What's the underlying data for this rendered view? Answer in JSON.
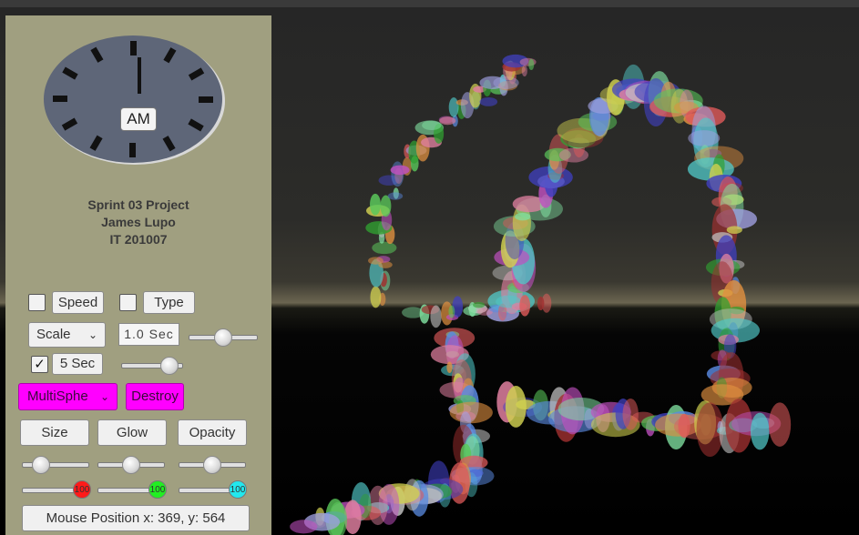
{
  "clock": {
    "period_label": "AM"
  },
  "project": {
    "title": "Sprint 03 Project",
    "author": "James Lupo",
    "course": "IT 201007"
  },
  "controls": {
    "speed": {
      "label": "Speed",
      "checked": false
    },
    "type": {
      "label": "Type",
      "checked": false
    },
    "scale_select": {
      "value": "Scale"
    },
    "interval_field": {
      "value": "1.0 Sec"
    },
    "interval_slider": {
      "level": 0.5
    },
    "timer_checkbox": {
      "checked": true,
      "mark": "✓"
    },
    "timer_label": "5 Sec",
    "timer_slider": {
      "level": 0.9
    },
    "shape_select": {
      "value": "MultiSphe"
    },
    "destroy_label": "Destroy",
    "size_label": "Size",
    "glow_label": "Glow",
    "opacity_label": "Opacity",
    "size_slider": {
      "level": 0.2
    },
    "glow_slider": {
      "level": 0.5
    },
    "opacity_slider": {
      "level": 0.5
    },
    "red_slider": {
      "value": "100",
      "color": "#ff1a1a"
    },
    "green_slider": {
      "value": "100",
      "color": "#22ee22"
    },
    "blue_slider": {
      "value": "100",
      "color": "#22e8ee"
    }
  },
  "status": {
    "mouse_position": "Mouse Position x: 369, y: 564"
  },
  "colors": {
    "panel": "#a09f80",
    "accent": "#ff00ff"
  }
}
